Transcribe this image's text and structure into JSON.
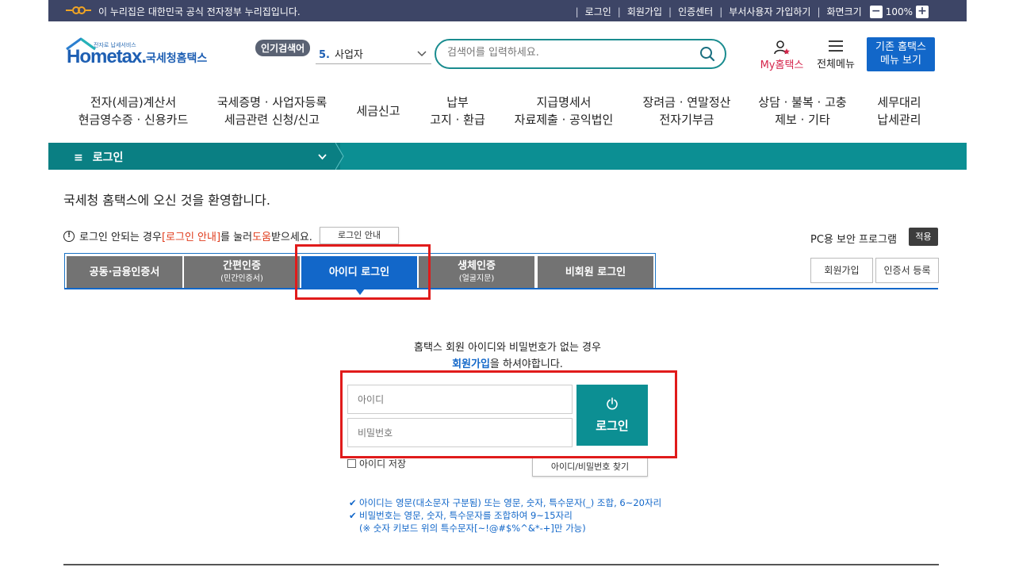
{
  "gov_bar": {
    "text": "이 누리집은 대한민국 공식 전자정부 누리집입니다.",
    "links": [
      "로그인",
      "회원가입",
      "인증센터",
      "부서사용자 가입하기",
      "화면크기"
    ],
    "zoom_minus": "−",
    "zoom_value": "100%",
    "zoom_plus": "+"
  },
  "header": {
    "logo_sub": "전자로 납세서비스",
    "logo_main": "Hometax.",
    "logo_kor": "국세청홈택스",
    "popular_badge": "인기검색어",
    "popular_rank": "5.",
    "popular_keyword": "사업자",
    "search_placeholder": "검색어를 입력하세요.",
    "my_home": "My홈택스",
    "all_menu": "전체메뉴",
    "legacy_line1": "기존 홈택스",
    "legacy_line2": "메뉴 보기"
  },
  "nav": [
    {
      "l1": "전자(세금)계산서",
      "l2": "현금영수증 · 신용카드"
    },
    {
      "l1": "국세증명 · 사업자등록",
      "l2": "세금관련 신청/신고"
    },
    {
      "l1": "세금신고",
      "l2": ""
    },
    {
      "l1": "납부",
      "l2": "고지 · 환급"
    },
    {
      "l1": "지급명세서",
      "l2": "자료제출 · 공익법인"
    },
    {
      "l1": "장려금 · 연말정산",
      "l2": "전자기부금"
    },
    {
      "l1": "상담 · 불복 · 고충",
      "l2": "제보 · 기타"
    },
    {
      "l1": "세무대리",
      "l2": "납세관리"
    }
  ],
  "breadcrumb": {
    "menu_icon": "≡",
    "label": "로그인"
  },
  "welcome": "국세청 홈택스에 오신 것을 환영합니다.",
  "help": {
    "pre": "로그인 안되는 경우 ",
    "red1": "[로그인 안내]",
    "mid": "를 눌러 ",
    "red2": "도움",
    "post": "받으세요.",
    "button": "로그인 안내"
  },
  "pc_security": {
    "label": "PC용 보안 프로그램",
    "apply": "적용"
  },
  "tabs": [
    {
      "label": "공동·금융인증서",
      "sub": ""
    },
    {
      "label": "간편인증",
      "sub": "(민간인증서)"
    },
    {
      "label": "아이디 로그인",
      "sub": ""
    },
    {
      "label": "생체인증",
      "sub": "(얼굴지문)"
    },
    {
      "label": "비회원 로그인",
      "sub": ""
    }
  ],
  "side_buttons": {
    "join": "회원가입",
    "cert": "인증서 등록"
  },
  "form": {
    "guide_line1": "홈택스 회원 아이디와 비밀번호가 없는 경우",
    "guide_link": "회원가입",
    "guide_line2_rest": "을 하셔야합니다.",
    "id_placeholder": "아이디",
    "pw_placeholder": "비밀번호",
    "login_label": "로그인",
    "save_id": "아이디 저장",
    "find": "아이디/비밀번호 찾기"
  },
  "rules": [
    "아이디는 영문(대소문자 구분됨) 또는 영문, 숫자, 특수문자(_) 조합, 6~20자리",
    "비밀번호는 영문, 숫자, 특수문자를 조합하여 9~15자리",
    "(※ 숫자 키보드 위의 특수문자[~!@#$%^&*-+]만 가능)"
  ]
}
